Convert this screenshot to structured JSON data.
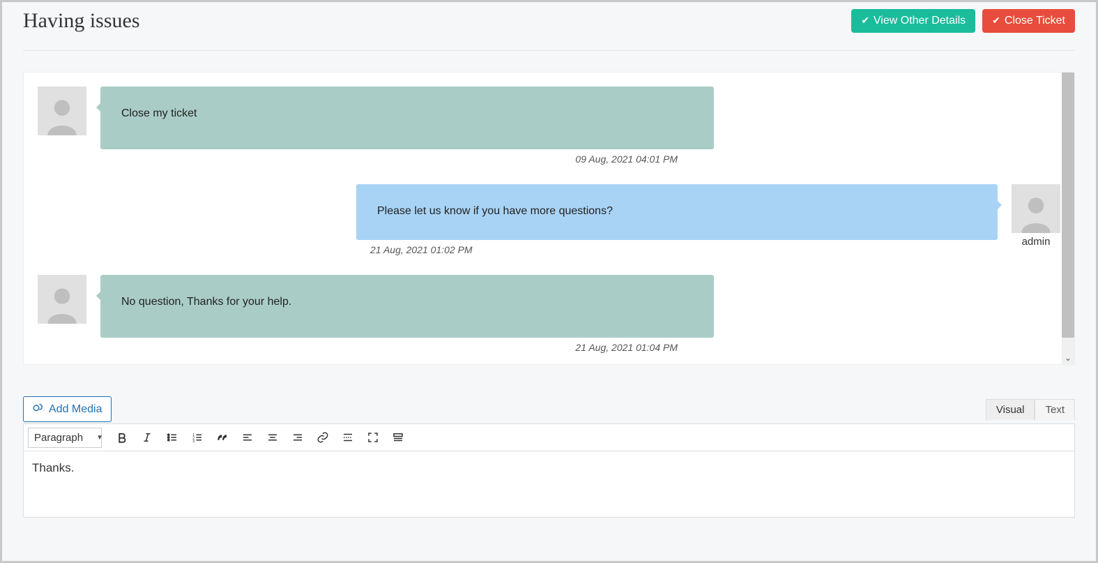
{
  "header": {
    "title": "Having issues",
    "view_details_label": "View Other Details",
    "close_ticket_label": "Close Ticket"
  },
  "messages": [
    {
      "side": "left",
      "role": "customer",
      "text": "Close my ticket",
      "timestamp": "09 Aug, 2021 04:01 PM",
      "author": ""
    },
    {
      "side": "right",
      "role": "agent",
      "text": "Please let us know if you have more questions?",
      "timestamp": "21 Aug, 2021 01:02 PM",
      "author": "admin"
    },
    {
      "side": "left",
      "role": "customer",
      "text": "No question, Thanks for your help.",
      "timestamp": "21 Aug, 2021 01:04 PM",
      "author": ""
    }
  ],
  "editor": {
    "add_media_label": "Add Media",
    "tabs": {
      "visual": "Visual",
      "text": "Text"
    },
    "format_select": "Paragraph",
    "content": "Thanks."
  }
}
